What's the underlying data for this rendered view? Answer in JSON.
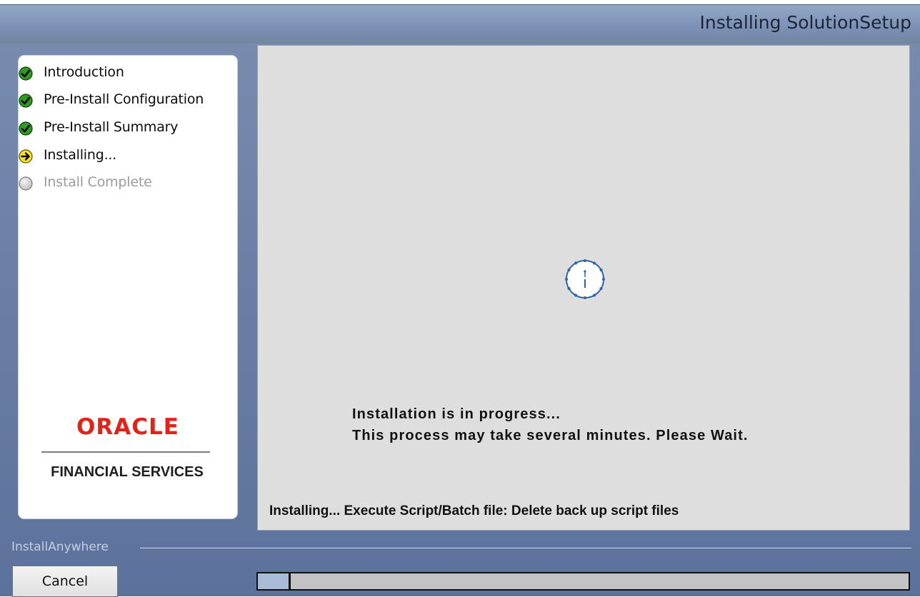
{
  "window": {
    "title": "Installing SolutionSetup"
  },
  "steps": [
    {
      "label": "Introduction",
      "status": "complete",
      "icon": "check-circle-icon"
    },
    {
      "label": "Pre-Install Configuration",
      "status": "complete",
      "icon": "check-circle-icon"
    },
    {
      "label": "Pre-Install Summary",
      "status": "complete",
      "icon": "check-circle-icon"
    },
    {
      "label": "Installing...",
      "status": "current",
      "icon": "arrow-right-circle-icon"
    },
    {
      "label": "Install Complete",
      "status": "pending",
      "icon": "empty-circle-icon"
    }
  ],
  "brand": {
    "name": "ORACLE",
    "subtitle": "FINANCIAL SERVICES"
  },
  "content": {
    "spinner_icon": "clock-spinner-icon",
    "message_line1": "Installation is in progress...",
    "message_line2": "This process may take several minutes. Please Wait.",
    "status_text": "Installing... Execute Script/Batch file: Delete back up script files"
  },
  "footer": {
    "brand_label": "InstallAnywhere",
    "cancel_label": "Cancel"
  },
  "progress": {
    "fraction": 0.05
  },
  "colors": {
    "accent": "#6a7ea5",
    "check_green": "#2f9a1f",
    "current_yellow": "#f5e22a",
    "pending_gray": "#cfcfcf",
    "brand_red": "#e2231a",
    "progress_fill": "#a9bbd6"
  }
}
